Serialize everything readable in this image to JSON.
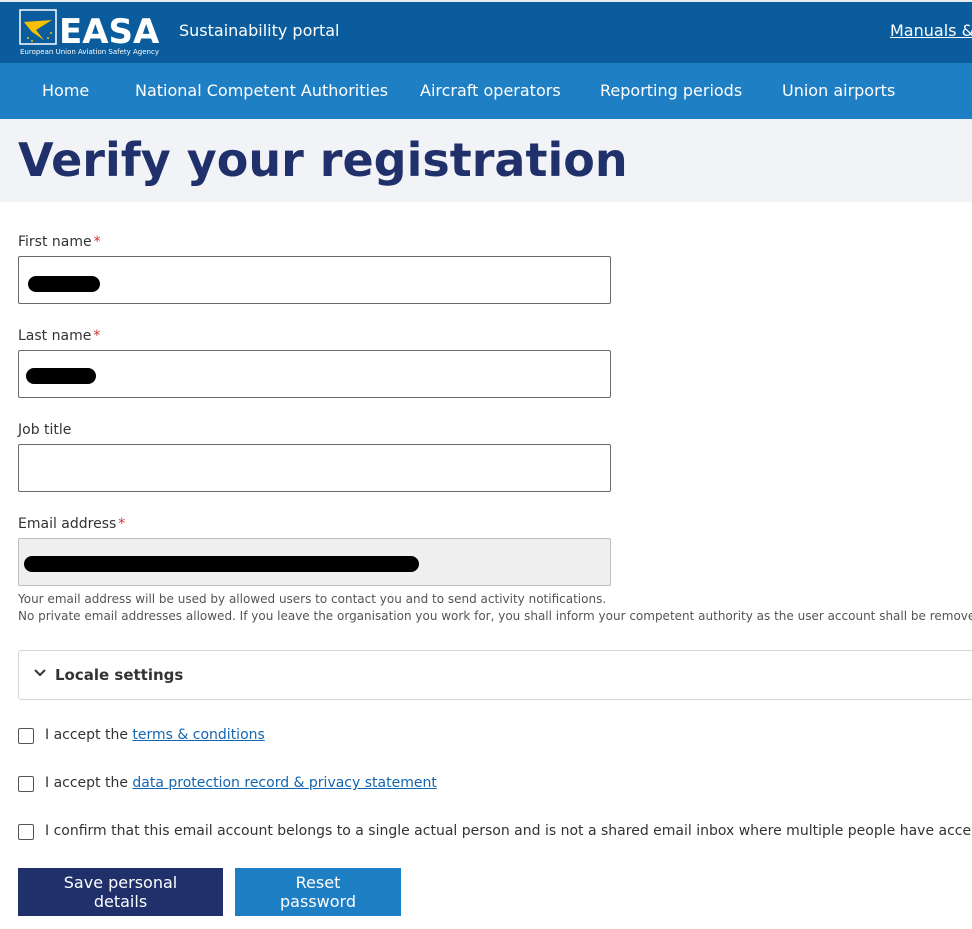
{
  "header": {
    "logo_text": "EASA",
    "logo_subtext": "European Union Aviation Safety Agency",
    "portal_name": "Sustainability portal",
    "manuals_link": "Manuals &"
  },
  "nav": {
    "items": [
      "Home",
      "National Competent Authorities",
      "Aircraft operators",
      "Reporting periods",
      "Union airports"
    ]
  },
  "page": {
    "title": "Verify your registration"
  },
  "form": {
    "first_name": {
      "label": "First name",
      "required": "*"
    },
    "last_name": {
      "label": "Last name",
      "required": "*"
    },
    "job_title": {
      "label": "Job title",
      "value": ""
    },
    "email": {
      "label": "Email address",
      "required": "*",
      "help_1": "Your email address will be used by allowed users to contact you and to send activity notifications.",
      "help_2": "No private email addresses allowed. If you leave the organisation you work for, you shall inform your competent authority as the user account shall be removed."
    },
    "locale": {
      "label": "Locale settings"
    },
    "checks": {
      "terms_prefix": "I accept the ",
      "terms_link": "terms & conditions",
      "privacy_prefix": "I accept the ",
      "privacy_link": "data protection record & privacy statement",
      "confirm_text": "I confirm that this email account belongs to a single actual person and is not a shared email inbox where multiple people have access to"
    },
    "buttons": {
      "save": "Save personal details",
      "reset": "Reset password"
    }
  },
  "colors": {
    "header_bg": "#0a5c9c",
    "nav_bg": "#1f7fc4",
    "title_color": "#20306a",
    "primary_button": "#20306a",
    "secondary_button": "#1f7fc4"
  }
}
